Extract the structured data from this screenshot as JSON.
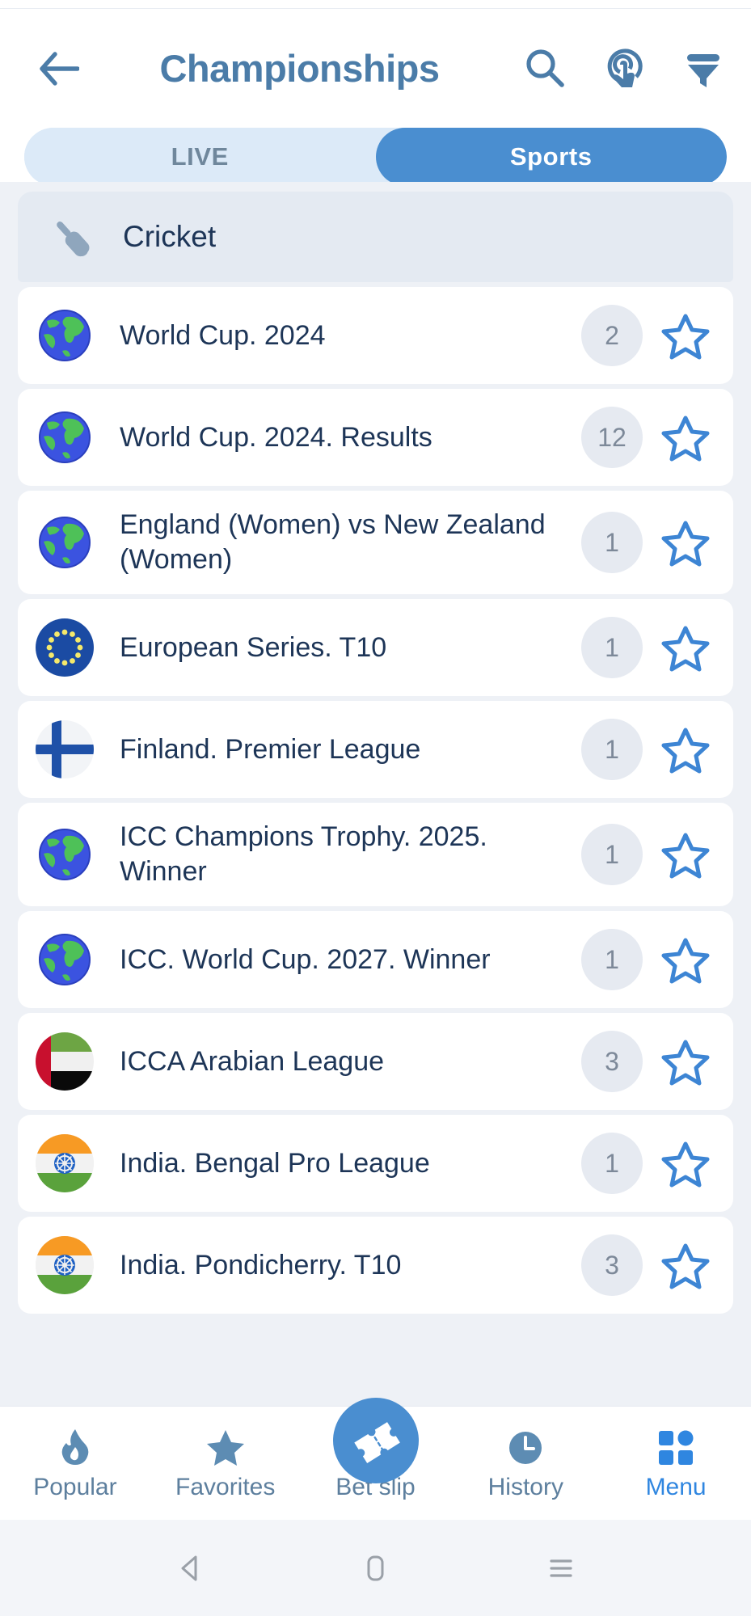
{
  "header": {
    "title": "Championships",
    "back_icon": "arrow-left-icon",
    "search_icon": "search-icon",
    "tap_icon": "tap-gesture-icon",
    "filter_icon": "filter-icon"
  },
  "tabs": [
    {
      "label": "LIVE",
      "active": false
    },
    {
      "label": "Sports",
      "active": true
    }
  ],
  "sport_section": {
    "name": "Cricket",
    "icon": "cricket-bat-ball-icon"
  },
  "leagues": [
    {
      "label": "World Cup. 2024",
      "count": "2",
      "flag": "globe",
      "starred": false
    },
    {
      "label": "World Cup. 2024. Results",
      "count": "12",
      "flag": "globe",
      "starred": false
    },
    {
      "label": "England (Women) vs New Zealand (Women)",
      "count": "1",
      "flag": "globe",
      "starred": false
    },
    {
      "label": "European Series. T10",
      "count": "1",
      "flag": "eu",
      "starred": false
    },
    {
      "label": "Finland. Premier League",
      "count": "1",
      "flag": "fi",
      "starred": false
    },
    {
      "label": "ICC Champions Trophy. 2025. Winner",
      "count": "1",
      "flag": "globe",
      "starred": false
    },
    {
      "label": "ICC. World Cup. 2027. Winner",
      "count": "1",
      "flag": "globe",
      "starred": false
    },
    {
      "label": "ICCA Arabian League",
      "count": "3",
      "flag": "ae",
      "starred": false
    },
    {
      "label": "India. Bengal Pro League",
      "count": "1",
      "flag": "in",
      "starred": false
    },
    {
      "label": "India. Pondicherry. T10",
      "count": "3",
      "flag": "in",
      "starred": false
    }
  ],
  "bottom_nav": [
    {
      "label": "Popular",
      "icon": "flame-icon",
      "active": false
    },
    {
      "label": "Favorites",
      "icon": "star-icon",
      "active": false
    },
    {
      "label": "Bet slip",
      "icon": "ticket-icon",
      "active": false
    },
    {
      "label": "History",
      "icon": "clock-icon",
      "active": false
    },
    {
      "label": "Menu",
      "icon": "grid-icon",
      "active": true
    }
  ],
  "android_nav": {
    "back": "triangle-back-icon",
    "home": "rounded-square-home-icon",
    "recents": "hamburger-recents-icon"
  },
  "colors": {
    "accent_blue": "#4a8ed0",
    "header_blue": "#4b7ca8",
    "text_navy": "#1d3557",
    "tab_inactive_bg": "#dceaf8",
    "badge_bg": "#e6eaf1",
    "page_bg": "#eef1f6"
  }
}
